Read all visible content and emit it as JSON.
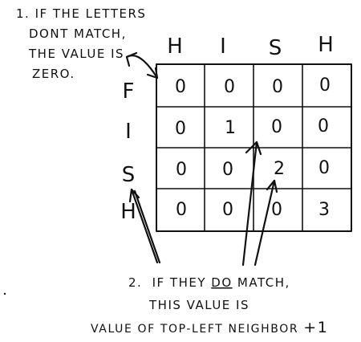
{
  "notes": {
    "note1": {
      "line1": "1. IF THE LETTERS",
      "line2": "DONT MATCH,",
      "line3": "THE VALUE IS",
      "line4": "ZERO."
    },
    "note2": {
      "number": "2.",
      "line1_pre": "IF THEY ",
      "line1_emph": "DO",
      "line1_post": " MATCH,",
      "line2": "THIS VALUE IS",
      "line3_pre": "VALUE OF TOP-LEFT NEIGHBOR ",
      "line3_plus": "+1"
    }
  },
  "grid": {
    "column_letters": [
      "H",
      "I",
      "S",
      "H"
    ],
    "row_letters": [
      "F",
      "I",
      "S",
      "H"
    ],
    "cells": [
      [
        "0",
        "0",
        "0",
        "0"
      ],
      [
        "0",
        "1",
        "0",
        "0"
      ],
      [
        "0",
        "0",
        "2",
        "0"
      ],
      [
        "0",
        "0",
        "0",
        "3"
      ]
    ]
  }
}
